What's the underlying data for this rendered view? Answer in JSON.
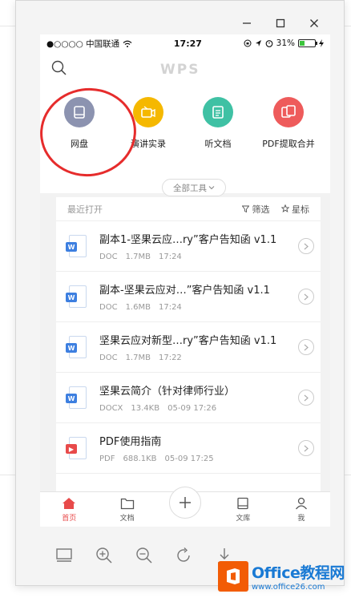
{
  "window": {
    "controls": [
      "minimize",
      "maximize",
      "close"
    ]
  },
  "statusbar": {
    "carrier": "●○○○○ 中国联通",
    "time": "17:27",
    "battery_text": "31%",
    "battery_level": 0.31,
    "battery_color": "#3cc43c"
  },
  "header": {
    "logo": "WPS"
  },
  "tools": [
    {
      "label": "网盘",
      "color": "#8c93b0",
      "icon": "cloud-drive-icon"
    },
    {
      "label": "演讲实录",
      "color": "#f5b800",
      "icon": "video-record-icon"
    },
    {
      "label": "听文档",
      "color": "#3fc1a4",
      "icon": "listen-doc-icon"
    },
    {
      "label": "PDF提取合并",
      "color": "#ee5b5b",
      "icon": "pdf-merge-icon"
    }
  ],
  "all_tools_label": "全部工具",
  "recent": {
    "title": "最近打开",
    "filter_label": "筛选",
    "star_label": "星标",
    "files": [
      {
        "name": "副本1-坚果云应…ry”客户告知函 v1.1",
        "type": "DOC",
        "size": "1.7MB",
        "time": "17:24",
        "tag": "W",
        "tag_color": "#3d7fe0"
      },
      {
        "name": "副本-坚果云应对…”客户告知函 v1.1",
        "type": "DOC",
        "size": "1.6MB",
        "time": "17:24",
        "tag": "W",
        "tag_color": "#3d7fe0"
      },
      {
        "name": "坚果云应对新型…ry”客户告知函 v1.1",
        "type": "DOC",
        "size": "1.7MB",
        "time": "17:22",
        "tag": "W",
        "tag_color": "#3d7fe0"
      },
      {
        "name": "坚果云简介（针对律师行业）",
        "type": "DOCX",
        "size": "13.4KB",
        "time": "05-09 17:26",
        "tag": "W",
        "tag_color": "#3d7fe0"
      },
      {
        "name": "PDF使用指南",
        "type": "PDF",
        "size": "688.1KB",
        "time": "05-09 17:25",
        "tag": "▶",
        "tag_color": "#e84a4a"
      }
    ]
  },
  "tabbar": {
    "home": "首页",
    "docs": "文档",
    "library": "文库",
    "me": "我"
  },
  "brand": {
    "title": "Office教程网",
    "url": "www.office26.com"
  }
}
